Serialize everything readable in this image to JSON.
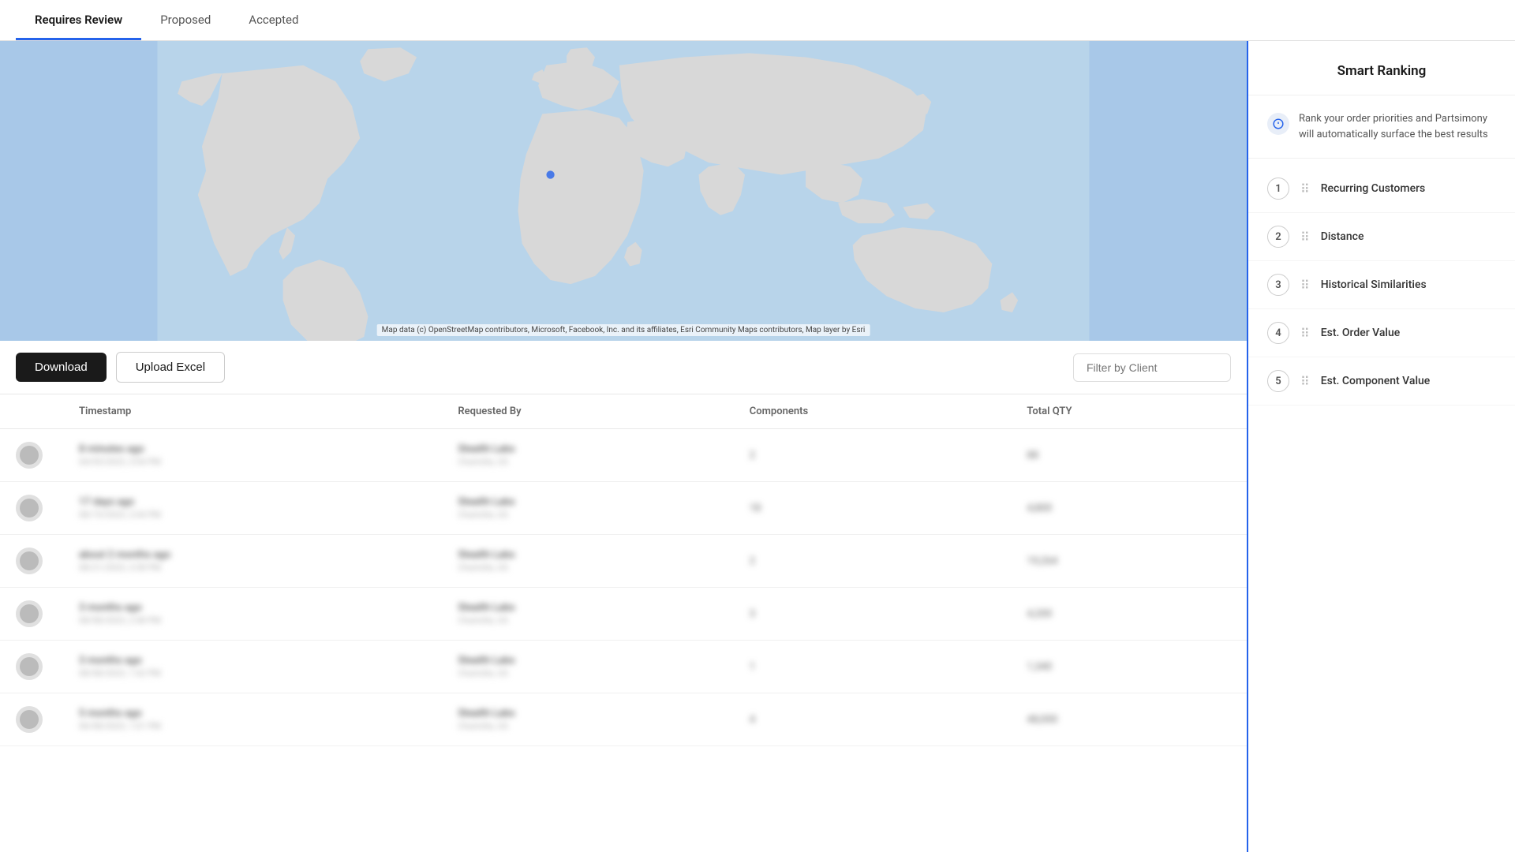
{
  "nav": {
    "tabs": [
      {
        "id": "requires-review",
        "label": "Requires Review",
        "active": true
      },
      {
        "id": "proposed",
        "label": "Proposed",
        "active": false
      },
      {
        "id": "accepted",
        "label": "Accepted",
        "active": false
      }
    ]
  },
  "map": {
    "attribution": "Map data (c) OpenStreetMap contributors, Microsoft, Facebook, Inc. and its affiliates, Esri Community Maps contributors, Map layer by Esri"
  },
  "toolbar": {
    "download_label": "Download",
    "upload_label": "Upload Excel",
    "filter_placeholder": "Filter by Client"
  },
  "table": {
    "columns": [
      "Timestamp",
      "Requested By",
      "Components",
      "Total QTY"
    ],
    "rows": [
      {
        "timestamp_main": "8 minutes ago",
        "timestamp_sub": "04/05/2023, 3:04 PM",
        "requested_main": "Stealth Labs",
        "requested_sub": "Charlotte, US",
        "components": "2",
        "total_qty": "88"
      },
      {
        "timestamp_main": "17 days ago",
        "timestamp_sub": "08/19/2023, 2:04 PM",
        "requested_main": "Stealth Labs",
        "requested_sub": "Charlotte, US",
        "components": "18",
        "total_qty": "4,800"
      },
      {
        "timestamp_main": "about 2 months ago",
        "timestamp_sub": "08/21/2023, 3:38 PM",
        "requested_main": "Stealth Labs",
        "requested_sub": "Charlotte, US",
        "components": "2",
        "total_qty": "19,264"
      },
      {
        "timestamp_main": "3 months ago",
        "timestamp_sub": "08/08/2023, 2:48 PM",
        "requested_main": "Stealth Labs",
        "requested_sub": "Charlotte, US",
        "components": "3",
        "total_qty": "4,200"
      },
      {
        "timestamp_main": "3 months ago",
        "timestamp_sub": "08/08/2023, 1:42 PM",
        "requested_main": "Stealth Labs",
        "requested_sub": "Charlotte, US",
        "components": "1",
        "total_qty": "1,340"
      },
      {
        "timestamp_main": "5 months ago",
        "timestamp_sub": "06/08/2023, 1:01 PM",
        "requested_main": "Stealth Labs",
        "requested_sub": "Charlotte, US",
        "components": "4",
        "total_qty": "48,000"
      }
    ]
  },
  "smart_ranking": {
    "title": "Smart Ranking",
    "description": "Rank your order priorities and Partsimony will automatically surface the best results",
    "items": [
      {
        "rank": 1,
        "label": "Recurring Customers"
      },
      {
        "rank": 2,
        "label": "Distance"
      },
      {
        "rank": 3,
        "label": "Historical Similarities"
      },
      {
        "rank": 4,
        "label": "Est. Order Value"
      },
      {
        "rank": 5,
        "label": "Est. Component Value"
      }
    ]
  }
}
